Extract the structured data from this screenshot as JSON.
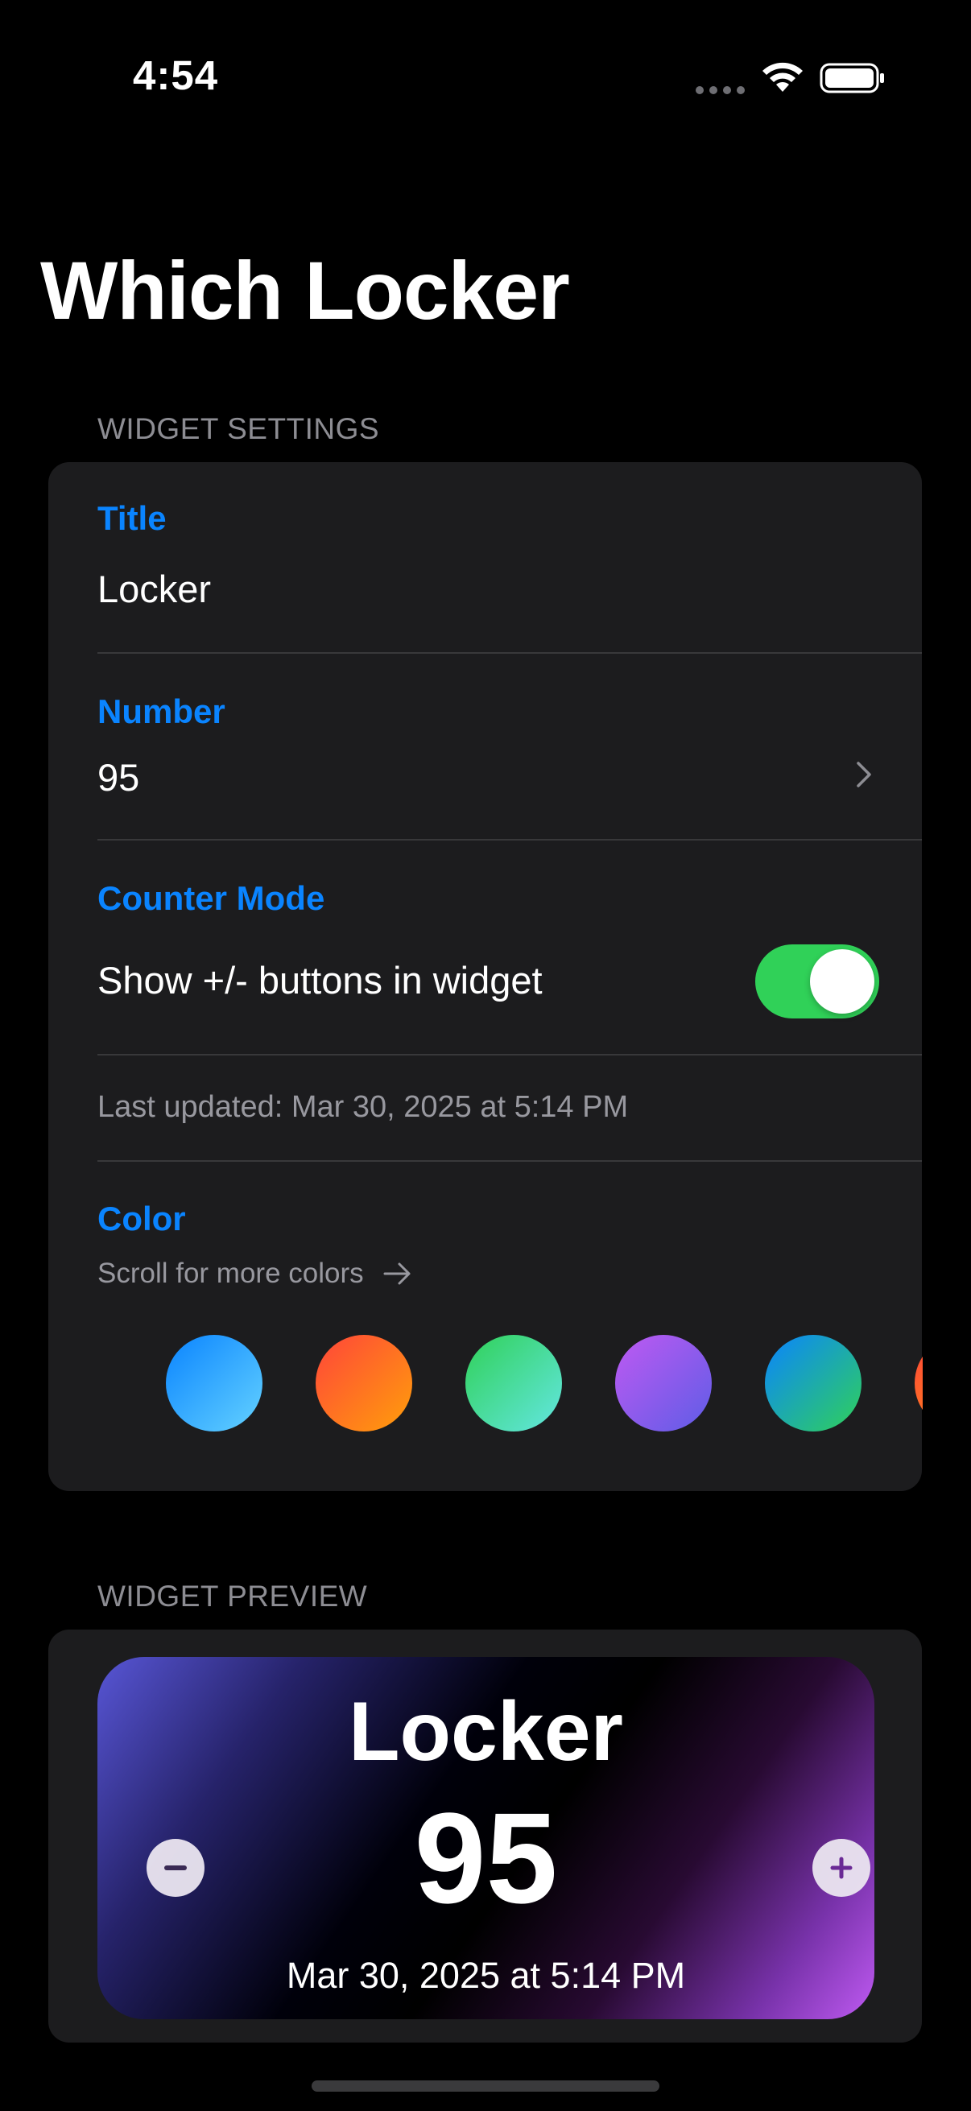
{
  "status_bar": {
    "time": "4:54"
  },
  "page": {
    "title": "Which Locker"
  },
  "settings": {
    "section_header": "WIDGET SETTINGS",
    "title_label": "Title",
    "title_value": "Locker",
    "number_label": "Number",
    "number_value": "95",
    "counter_label": "Counter Mode",
    "counter_toggle_label": "Show +/- buttons in widget",
    "counter_toggle_on": true,
    "last_updated": "Last updated: Mar 30, 2025 at 5:14 PM",
    "color_label": "Color",
    "color_hint": "Scroll for more colors",
    "swatches": [
      {
        "name": "blue",
        "from": "#0a84ff",
        "to": "#64d2ff"
      },
      {
        "name": "orange",
        "from": "#ff453a",
        "to": "#ff9f0a"
      },
      {
        "name": "green",
        "from": "#30d158",
        "to": "#63e6e2"
      },
      {
        "name": "purple",
        "from": "#bf5af2",
        "to": "#5e5ce6"
      },
      {
        "name": "teal-blue",
        "from": "#0a84ff",
        "to": "#30d158"
      },
      {
        "name": "orange-partial",
        "from": "#ff453a",
        "to": "#ff9f0a"
      }
    ]
  },
  "preview": {
    "section_header": "WIDGET PREVIEW",
    "widget_title": "Locker",
    "widget_number": "95",
    "widget_date": "Mar 30, 2025 at 5:14 PM"
  },
  "colors": {
    "accent": "#0a84ff",
    "toggle_on": "#30d158",
    "card_bg": "#1c1c1e",
    "secondary_text": "#98989f"
  }
}
